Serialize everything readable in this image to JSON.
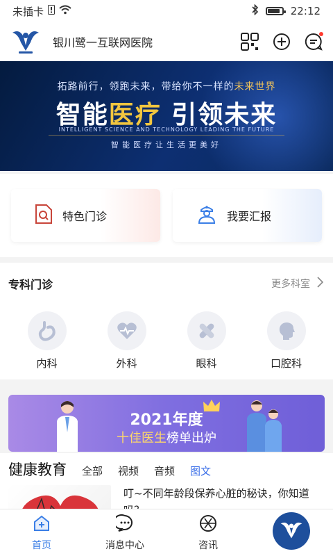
{
  "status_bar": {
    "carrier": "未插卡",
    "time": "22:12",
    "battery_level": 0.8
  },
  "header": {
    "app_title": "银川鹭一互联网医院",
    "icons": [
      "qr-code-icon",
      "add-circle-icon",
      "message-icon"
    ]
  },
  "banner": {
    "line1_prefix": "拓路前行，领跑未来，带给你不一样的",
    "line1_highlight": "未来世界",
    "main_part1": "智能",
    "main_highlight": "医疗",
    "main_part2": " 引领未来",
    "english": "INTELLIGENT SCIENCE AND TECHNOLOGY LEADING THE FUTURE",
    "slogan": "智能医疗让生活更美好"
  },
  "quick_actions": [
    {
      "label": "特色门诊",
      "icon": "document-search-icon"
    },
    {
      "label": "我要汇报",
      "icon": "doctor-icon"
    }
  ],
  "specialties": {
    "title": "专科门诊",
    "more_label": "更多科室",
    "items": [
      {
        "label": "内科",
        "icon": "stomach-icon"
      },
      {
        "label": "外科",
        "icon": "heart-icon"
      },
      {
        "label": "眼科",
        "icon": "bandage-icon"
      },
      {
        "label": "口腔科",
        "icon": "head-icon"
      }
    ]
  },
  "promo": {
    "year_title": "2021年度",
    "subtitle_highlight": "十佳医生",
    "subtitle_rest": "榜单出炉"
  },
  "education": {
    "title": "健康教育",
    "tabs": [
      "全部",
      "视频",
      "音频",
      "图文"
    ],
    "active_tab": 3,
    "article_text": "叮~不同年龄段保养心脏的秘诀，你知道吗？"
  },
  "tabbar": {
    "items": [
      {
        "label": "首页",
        "icon": "home-icon"
      },
      {
        "label": "消息中心",
        "icon": "chat-icon"
      },
      {
        "label": "咨讯",
        "icon": "aperture-icon"
      }
    ],
    "active_index": 0
  },
  "colors": {
    "accent": "#3a7ee6",
    "banner_gold": "#f2c63f",
    "promo": "#7f6ee0"
  }
}
